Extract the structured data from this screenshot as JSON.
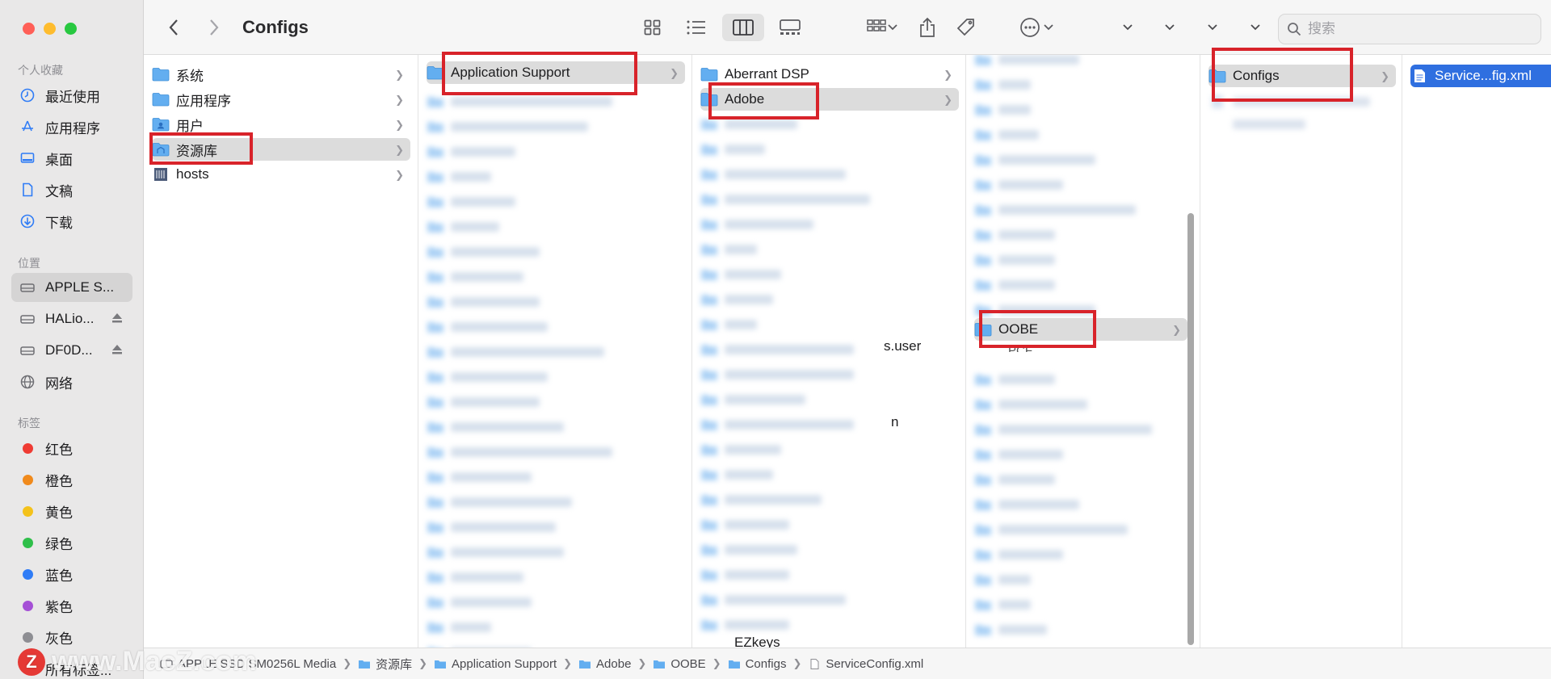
{
  "window": {
    "title": "Configs"
  },
  "sidebar": {
    "favorites_header": "个人收藏",
    "favorites": [
      {
        "label": "最近使用",
        "icon": "clock-icon"
      },
      {
        "label": "应用程序",
        "icon": "apps-icon"
      },
      {
        "label": "桌面",
        "icon": "desktop-icon"
      },
      {
        "label": "文稿",
        "icon": "document-icon"
      },
      {
        "label": "下载",
        "icon": "download-icon"
      }
    ],
    "locations_header": "位置",
    "locations": [
      {
        "label": "APPLE S...",
        "icon": "drive-icon",
        "eject": false,
        "selected": true
      },
      {
        "label": "HALio...",
        "icon": "drive-icon",
        "eject": true
      },
      {
        "label": "DF0D...",
        "icon": "drive-icon",
        "eject": true
      },
      {
        "label": "网络",
        "icon": "network-icon"
      }
    ],
    "tags_header": "标签",
    "tags": [
      {
        "label": "红色",
        "color": "#ef3b33"
      },
      {
        "label": "橙色",
        "color": "#f08a1c"
      },
      {
        "label": "黄色",
        "color": "#f4c21b"
      },
      {
        "label": "绿色",
        "color": "#2fbf4a"
      },
      {
        "label": "蓝色",
        "color": "#2f7cf6"
      },
      {
        "label": "紫色",
        "color": "#a550d6"
      },
      {
        "label": "灰色",
        "color": "#8e8e93"
      },
      {
        "label": "所有标签..."
      }
    ]
  },
  "toolbar": {
    "search_placeholder": "搜索"
  },
  "columns": {
    "col1": [
      "系统",
      "应用程序",
      "用户",
      "资源库",
      "hosts"
    ],
    "col2_selected": "Application Support",
    "col3": [
      "Aberrant DSP",
      "Adobe"
    ],
    "col3_partial": [
      "s.user",
      "n",
      "EZkeys"
    ],
    "col4_selected": "OOBE",
    "col4_partial": "PCF",
    "col5_selected": "Configs",
    "col6_selected": "Service...fig.xml"
  },
  "pathbar": [
    {
      "label": "APPLE SSD SM0256L Media",
      "icon": "drive-icon"
    },
    {
      "label": "资源库",
      "icon": "folder-icon"
    },
    {
      "label": "Application Support",
      "icon": "folder-icon"
    },
    {
      "label": "Adobe",
      "icon": "folder-icon"
    },
    {
      "label": "OOBE",
      "icon": "folder-icon"
    },
    {
      "label": "Configs",
      "icon": "folder-icon"
    },
    {
      "label": "ServiceConfig.xml",
      "icon": "file-icon"
    }
  ],
  "watermark": {
    "text": "www.MacZ.com",
    "logo": "Z"
  }
}
